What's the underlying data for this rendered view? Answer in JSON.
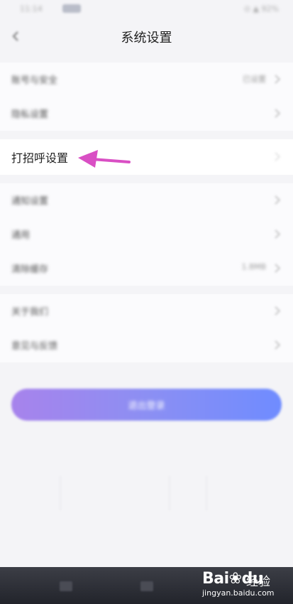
{
  "status_bar": {
    "time": "11:14",
    "badge": "",
    "right": "⊙ ▲ 92%"
  },
  "header": {
    "title": "系统设置"
  },
  "group1": [
    {
      "label": "账号与安全",
      "value": "已设置"
    },
    {
      "label": "隐私设置",
      "value": ""
    }
  ],
  "focused_row": {
    "label": "打招呼设置"
  },
  "group2": [
    {
      "label": "通知设置",
      "value": ""
    },
    {
      "label": "通用",
      "value": ""
    },
    {
      "label": "清除缓存",
      "value": "1.8MB"
    }
  ],
  "group3": [
    {
      "label": "关于我们",
      "value": ""
    },
    {
      "label": "意见与反馈",
      "value": ""
    }
  ],
  "primary_button": {
    "label": "退出登录"
  },
  "watermark": {
    "logo": "Bai",
    "logo_tail": "du",
    "brand": "经验",
    "url": "jingyan.baidu.com"
  },
  "annotation_color": "#d94fc4"
}
